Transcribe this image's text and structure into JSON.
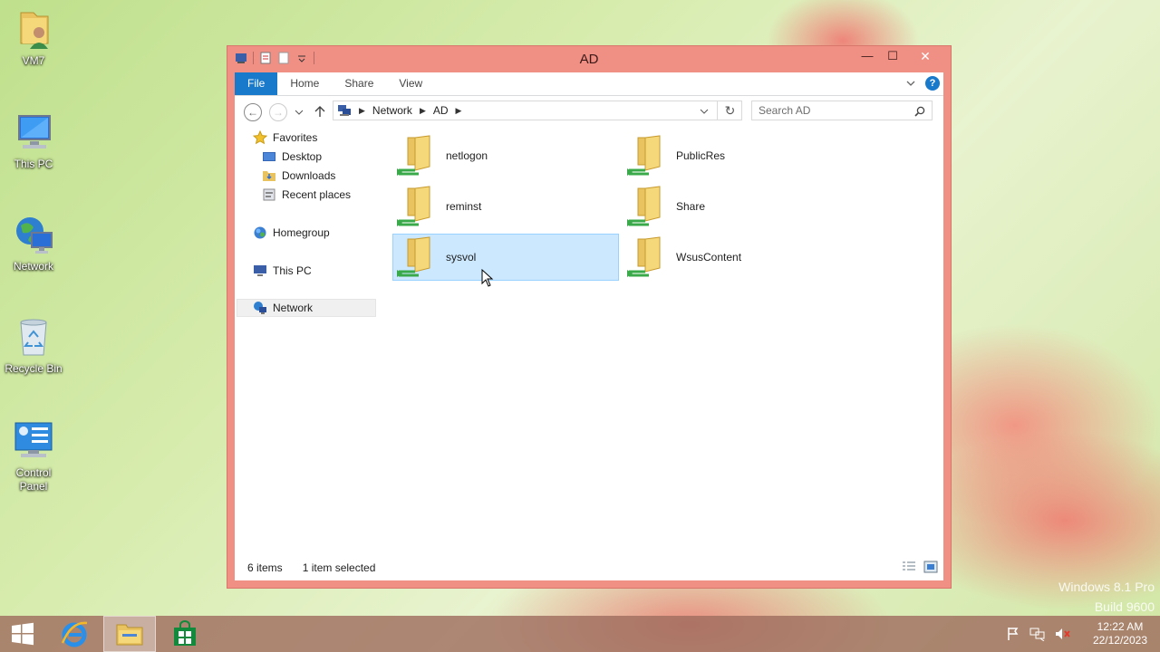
{
  "desktop": {
    "icons": [
      {
        "label": "VM7"
      },
      {
        "label": "This PC"
      },
      {
        "label": "Network"
      },
      {
        "label": "Recycle Bin"
      },
      {
        "label": "Control Panel"
      }
    ]
  },
  "window": {
    "title": "AD",
    "controls": {
      "minimize": "—",
      "maximize": "☐",
      "close": "✕"
    }
  },
  "ribbon": {
    "tabs": [
      {
        "label": "File"
      },
      {
        "label": "Home"
      },
      {
        "label": "Share"
      },
      {
        "label": "View"
      }
    ],
    "help": "?"
  },
  "address_bar": {
    "breadcrumbs": [
      "Network",
      "AD"
    ]
  },
  "search": {
    "placeholder": "Search AD"
  },
  "nav_pane": {
    "favorites": "Favorites",
    "desktop": "Desktop",
    "downloads": "Downloads",
    "recent_places": "Recent places",
    "homegroup": "Homegroup",
    "this_pc": "This PC",
    "network": "Network"
  },
  "folders": [
    {
      "name": "netlogon",
      "selected": false
    },
    {
      "name": "PublicRes",
      "selected": false
    },
    {
      "name": "reminst",
      "selected": false
    },
    {
      "name": "Share",
      "selected": false
    },
    {
      "name": "sysvol",
      "selected": true
    },
    {
      "name": "WsusContent",
      "selected": false
    }
  ],
  "status": {
    "item_count": "6 items",
    "selection": "1 item selected"
  },
  "watermark": {
    "line1": "Windows 8.1 Pro",
    "line2": "Build 9600"
  },
  "taskbar": {
    "clock_time": "12:22 AM",
    "clock_date": "22/12/2023"
  },
  "colors": {
    "window_frame": "#f08f84",
    "accent": "#1979ca",
    "selection": "#cce8ff"
  }
}
